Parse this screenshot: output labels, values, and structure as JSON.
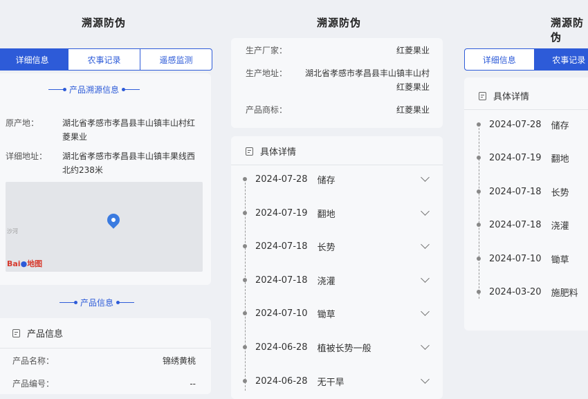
{
  "colors": {
    "accent": "#2d5bd8",
    "page_bg": "#eef0f4",
    "card_bg": "#f7f8fa"
  },
  "left": {
    "title": "溯源防伪",
    "tabs": [
      "详细信息",
      "农事记录",
      "遥感监测"
    ],
    "trace_section": "产品溯源信息",
    "origin": {
      "label": "原产地：",
      "value": "湖北省孝感市孝昌县丰山镇丰山村红菱果业"
    },
    "address": {
      "label": "详细地址：",
      "value": "湖北省孝感市孝昌县丰山镇丰果线西北约238米"
    },
    "map": {
      "tiny_text": "沙河",
      "baidu_text": "Bai",
      "baidu_cn": "地图",
      "pin_icon": "location-pin-icon"
    },
    "product_section": "产品信息",
    "product_card": {
      "title": "产品信息",
      "rows": [
        {
          "label": "产品名称：",
          "value": "锦绣黄桃"
        },
        {
          "label": "产品编号：",
          "value": "--"
        }
      ]
    }
  },
  "middle": {
    "title": "溯源防伪",
    "info": [
      {
        "label": "生产厂家：",
        "value": "红菱果业"
      },
      {
        "label": "生产地址：",
        "value": "湖北省孝感市孝昌县丰山镇丰山村红菱果业"
      },
      {
        "label": "产品商标：",
        "value": "红菱果业"
      }
    ],
    "details_title": "具体详情",
    "timeline": [
      {
        "date": "2024-07-28",
        "label": "储存"
      },
      {
        "date": "2024-07-19",
        "label": "翻地"
      },
      {
        "date": "2024-07-18",
        "label": "长势"
      },
      {
        "date": "2024-07-18",
        "label": "浇灌"
      },
      {
        "date": "2024-07-10",
        "label": "锄草"
      },
      {
        "date": "2024-06-28",
        "label": "植被长势一般"
      },
      {
        "date": "2024-06-28",
        "label": "无干旱"
      }
    ]
  },
  "right": {
    "title": "溯源防伪",
    "tabs": [
      "详细信息",
      "农事记录"
    ],
    "details_title": "具体详情",
    "timeline": [
      {
        "date": "2024-07-28",
        "label": "储存"
      },
      {
        "date": "2024-07-19",
        "label": "翻地"
      },
      {
        "date": "2024-07-18",
        "label": "长势"
      },
      {
        "date": "2024-07-18",
        "label": "浇灌"
      },
      {
        "date": "2024-07-10",
        "label": "锄草"
      },
      {
        "date": "2024-03-20",
        "label": "施肥料"
      }
    ]
  }
}
